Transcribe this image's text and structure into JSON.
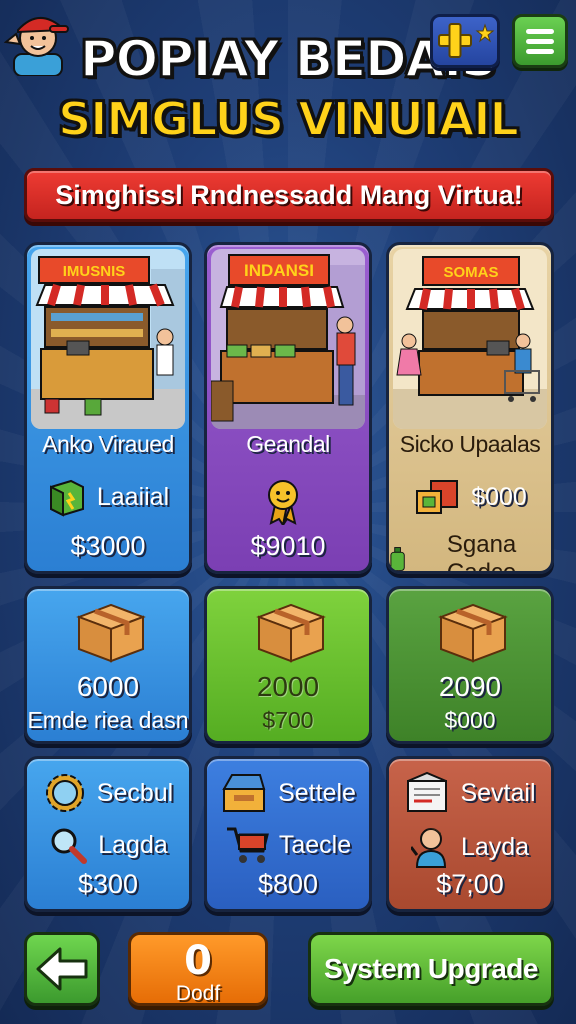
{
  "header": {
    "title_line1": "POPIAY BEDAIS",
    "title_line2": "SIMGLUS VINUIAIL",
    "add_icon": "plus-star-icon",
    "menu_icon": "hamburger-menu-icon"
  },
  "banner": {
    "text": "Simghiѕsl Rndnessadd Mang Virtua!"
  },
  "stores": [
    {
      "sign": "IMUSNIS",
      "name": "Anko Viraued",
      "stat_label": "Laaiial",
      "price": "$3000",
      "stat_icon": "green-cube-icon"
    },
    {
      "sign": "INDANSI",
      "name": "Geandal",
      "stat_label": "",
      "price": "$9010",
      "stat_icon": "gold-medal-icon"
    },
    {
      "sign": "SOMAS",
      "name": "Sicko Upaalas",
      "stat_label": "$000",
      "price": "Sgana Cadce",
      "stat_icon": "cube-stack-icon",
      "price_icon": "bottle-icon"
    }
  ],
  "supplies": [
    {
      "qty": "6000",
      "sub": "Emde riea dasn"
    },
    {
      "qty": "2000",
      "sub": "$700"
    },
    {
      "qty": "2090",
      "sub": "$000"
    }
  ],
  "upgrades": [
    {
      "label1": "Secbul",
      "label2": "Lagda",
      "price": "$300",
      "icon1": "gear-icon",
      "icon2": "magnifier-icon"
    },
    {
      "label1": "Settele",
      "label2": "Taecle",
      "price": "$800",
      "icon1": "open-crate-icon",
      "icon2": "shopping-cart-icon"
    },
    {
      "label1": "Sevtail",
      "label2": "Layda",
      "price": "$7;00",
      "icon1": "document-box-icon",
      "icon2": "person-icon"
    }
  ],
  "bottom": {
    "back_icon": "arrow-left-icon",
    "counter_value": "0",
    "counter_label": "Dodf",
    "upgrade_label": "System Upgrade"
  },
  "colors": {
    "background": "#1f3f78",
    "banner": "#d8302a",
    "title_yellow": "#ffd21a",
    "card_blue": "#2b7fd3",
    "card_purple": "#7b3fb3",
    "card_beige": "#d3b77f",
    "card_green": "#55ad22",
    "card_dark_green": "#3e8228",
    "card_rust": "#a9492f",
    "counter_orange": "#e66d06"
  }
}
